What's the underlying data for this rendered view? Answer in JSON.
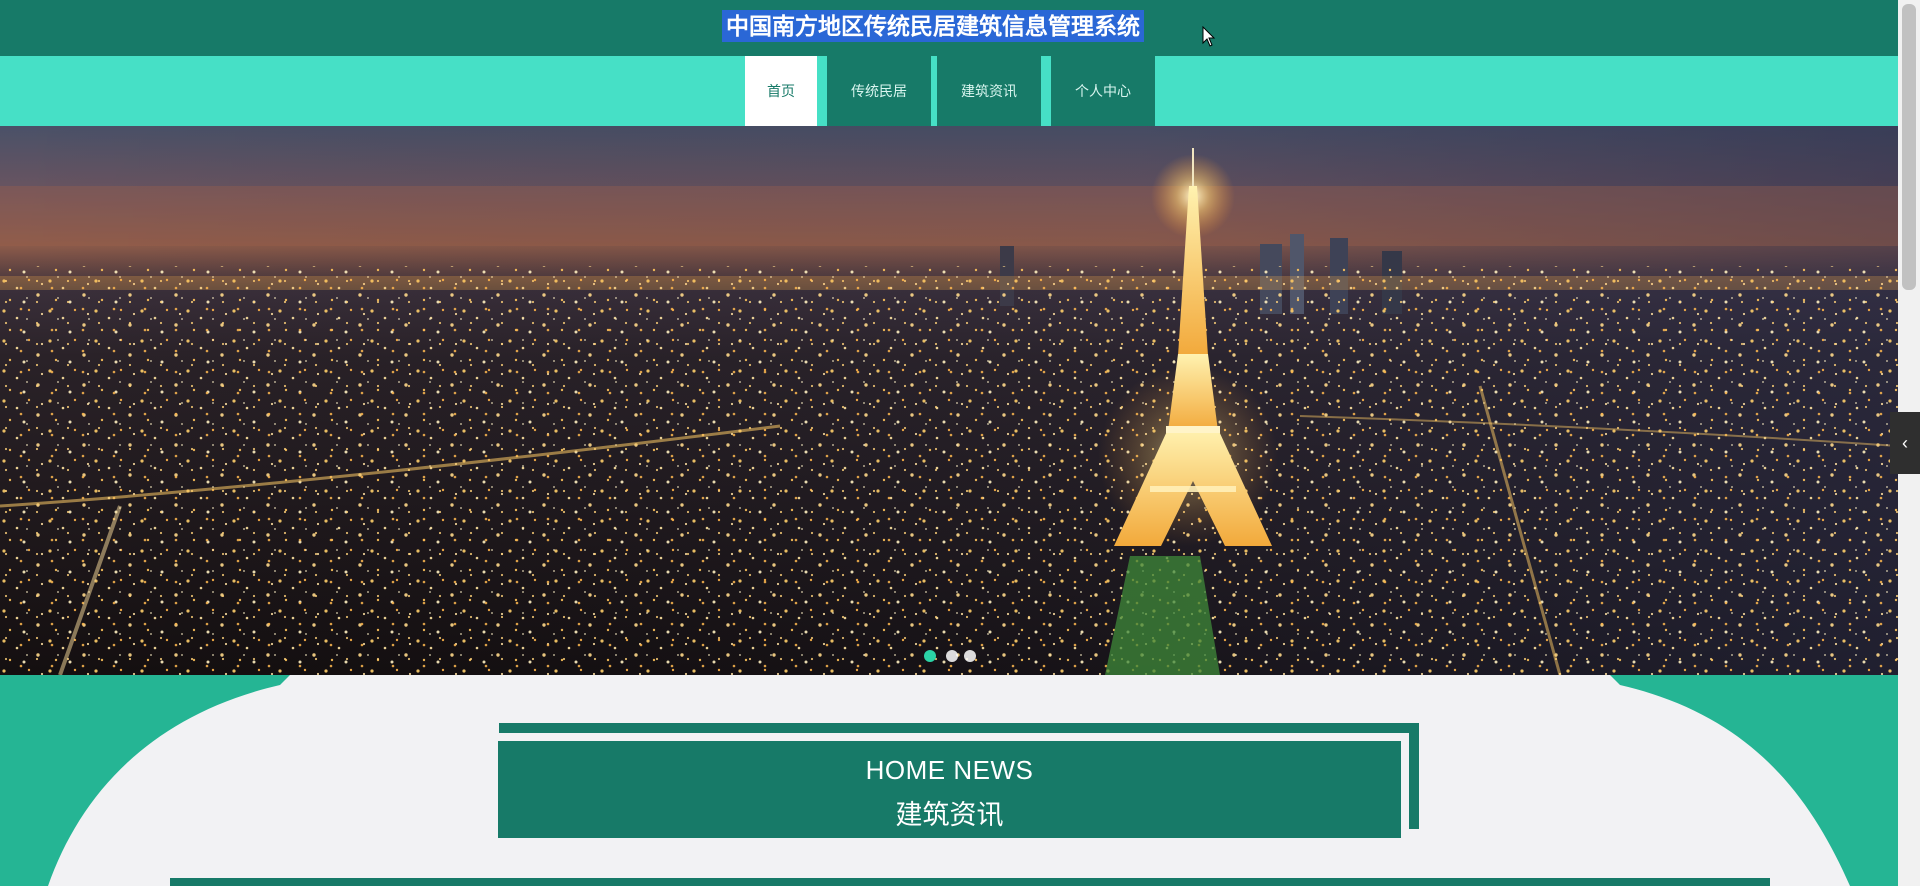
{
  "header": {
    "site_title": "中国南方地区传统民居建筑信息管理系统"
  },
  "nav": {
    "items": [
      {
        "label": "首页",
        "active": true
      },
      {
        "label": "传统民居",
        "active": false
      },
      {
        "label": "建筑资讯",
        "active": false
      },
      {
        "label": "个人中心",
        "active": false
      }
    ]
  },
  "carousel": {
    "slide_count": 3,
    "active_index": 0
  },
  "news_section": {
    "title_en": "HOME NEWS",
    "title_cn": "建筑资讯"
  },
  "theme": {
    "primary": "#177a68",
    "accent": "#46e0c6",
    "dot_active": "#2bd3a6"
  },
  "icons": {
    "cursor": "mouse-pointer-icon",
    "side_toggle": "chevron-left-icon"
  }
}
